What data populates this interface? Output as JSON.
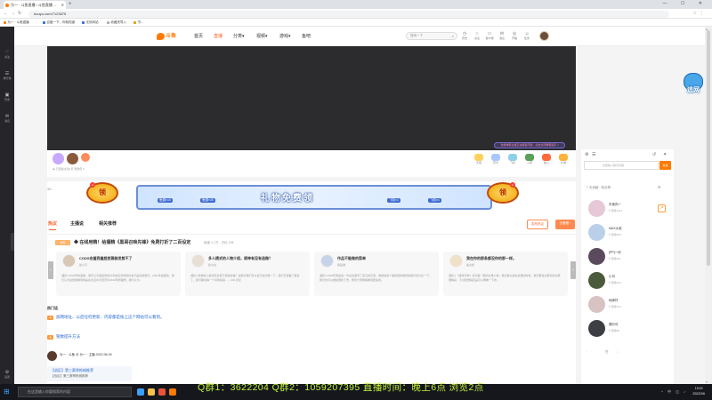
{
  "browser": {
    "tab_title": "为一 · 斗鱼直播 / 斗鱼直播 ...",
    "new_tab": "+",
    "window_controls": "— ☐ ✕",
    "address": "douyu.com/7123675",
    "bookmarks": [
      "为一 · 斗鱼直播",
      "百度一下，你就知道",
      "无忧网站",
      "收藏夹导入",
      "书..."
    ]
  },
  "left_rail": {
    "items": [
      {
        "icon": "♡",
        "label": "关注"
      },
      {
        "icon": "☰",
        "label": "排行榜"
      },
      {
        "icon": "▣",
        "label": "历史"
      },
      {
        "icon": "✉",
        "label": "消息"
      },
      {
        "icon": "⚙",
        "label": "设置"
      }
    ]
  },
  "header": {
    "logo_text": "斗鱼",
    "nav": [
      "首页",
      "直播",
      "分类▾",
      "视频▾",
      "游戏▾",
      "鱼吧"
    ],
    "active_nav": "直播",
    "search_placeholder": "搜索一下",
    "icons": [
      {
        "icon": "◷",
        "label": "历史"
      },
      {
        "icon": "☆",
        "label": "关注"
      },
      {
        "icon": "▭",
        "label": "客户端"
      },
      {
        "icon": "✉",
        "label": "消息"
      },
      {
        "icon": "◎",
        "label": "开播"
      },
      {
        "icon": "☺",
        "label": "任务"
      }
    ]
  },
  "player": {
    "tip_text": "当前弹幕主播正在解答问题，点击关闭弹幕提示 ×"
  },
  "controls": {
    "left_text": "★ 已连续关注1天 贡献值 0",
    "right_gifts": [
      "天使",
      "荧光",
      "飞机",
      "火箭",
      "超火",
      "礼物"
    ]
  },
  "banner": {
    "left_label": "3D",
    "ling": "领",
    "badge_count": "1",
    "title": "礼物免费领",
    "chips": [
      "鱼翅×10",
      "鱼翅×30",
      "飞机×1",
      "飞机×1"
    ]
  },
  "tabs": {
    "items": [
      "热议",
      "主播说",
      "相关推荐"
    ],
    "active": "热议",
    "btn1": "发布热议",
    "btn2": "去看看 ›"
  },
  "notice": {
    "tag": "推荐",
    "title": "◆ 在线用精！给播精《黑哥召唤先锋》免费打折了二百设定",
    "meta": "阅读 1.7万 · 讨论 128"
  },
  "cards": [
    {
      "title": "CODS合盖我盖超变雅装发剪不了",
      "author": "晨小可",
      "body": "[图片] 2022年的第数，我们认为我最经常分享的应该特别好本不是说到我们。2021年是部的，我们认为最经常看到的是先生活水平经济与2022年的理想，我们认为..."
    },
    {
      "title": "多人模式的人物介绍，原神有没有选做？",
      "author": "鱼大白",
      "body": "[图片] 原神多人模式究竟值不值得去做？这部分我们可以自己去比较一下，我们已经做了很多了，我们都在等一个好的答案……100 评论"
    },
    {
      "title": "作品不能做的菜单",
      "author": "我是谁",
      "body": "[图片] 2022年我最后一次在这里写了自己的东西，我觉得这个事情真的很值得我们去讨论一下，我们也可以继续更新下去，希望大家能够看到更多的。"
    },
    {
      "title": "我在你的那条都没你的那一样。",
      "author": "鱼丸饭",
      "body": "[图片] 《游戏与你》系列第一部的主角人物，我记得以前在这里的时候，我们都说过那次的比赛很精彩，不过我觉得还是可以再看一下的…"
    }
  ],
  "lower": {
    "heading": "热门话",
    "link1": "加网地址、以后任何更新、内容都是按上这个网站可以看到。",
    "link2": "铭数提升方法",
    "post_name": "为一 · 斗鱼   ⊕ 为一 · 主播   2022-06-09",
    "box_line1": "【战区】第三赛季枪械推荐",
    "box_line2": "【战区】第三赛季枪械推荐"
  },
  "sidebar": {
    "icons": [
      "⚙",
      "☰",
      "↺",
      "✦"
    ],
    "input_placeholder": "这里输入聊天内容",
    "send": "发送",
    "section_title": "7 天贡献 · 粉丝榜",
    "setting_icon": "⚙",
    "badge": "↗",
    "ranks": [
      {
        "name": "东坡肉一",
        "sub": "♥ 贡献1314"
      },
      {
        "name": "MAX大老",
        "sub": "♥ 贡献928"
      },
      {
        "name": "[PP]一块",
        "sub": "♥ 贡献521"
      },
      {
        "name": "小可",
        "sub": "♥ 贡献233"
      },
      {
        "name": "地球村",
        "sub": "♥ 贡献120"
      },
      {
        "name": "偶尔可",
        "sub": "♥ 贡献88"
      }
    ],
    "bottom": "··· 🗑 ⛶"
  },
  "mascot": {
    "text": "追网"
  },
  "overlay_caption": "Q群1：3622204 Q群2：1059207395  直播时间：晚上6点 浏览2点",
  "taskbar": {
    "search": "在这里输入你要搜索的内容",
    "tray": "^ 中 ◫ ♪",
    "time": "19:02",
    "date": "2022/2/6"
  },
  "colors": {
    "accent": "#ff5d23",
    "brand": "#ff7a00",
    "overlay": "#c2f238"
  }
}
